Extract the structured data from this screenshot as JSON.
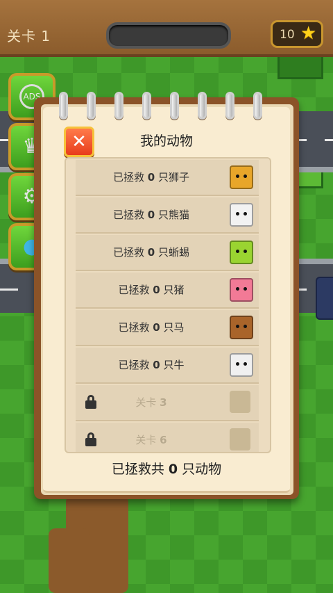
{
  "top_bar": {
    "level_label": "关卡 1",
    "progress_fraction": 0.0,
    "stars": "10",
    "star_icon": "star-icon"
  },
  "side_buttons": [
    {
      "icon": "no-ads-icon",
      "glyph": "ADS"
    },
    {
      "icon": "trophy-icon",
      "glyph": "🏆"
    },
    {
      "icon": "gear-icon",
      "glyph": "⚙"
    },
    {
      "icon": "bird-icon",
      "glyph": "🐦"
    }
  ],
  "panel": {
    "title": "我的动物",
    "close_icon": "close-icon",
    "rows": [
      {
        "prefix": "已拯救 ",
        "count": "0",
        "suffix": " 只狮子",
        "icon": "lion-icon",
        "color": "#e8a62a",
        "locked": false
      },
      {
        "prefix": "已拯救 ",
        "count": "0",
        "suffix": " 只熊猫",
        "icon": "panda-icon",
        "color": "#f2f2f2",
        "locked": false
      },
      {
        "prefix": "已拯救 ",
        "count": "0",
        "suffix": " 只蜥蜴",
        "icon": "lizard-icon",
        "color": "#9ad431",
        "locked": false
      },
      {
        "prefix": "已拯救 ",
        "count": "0",
        "suffix": " 只猪",
        "icon": "pig-icon",
        "color": "#f27a96",
        "locked": false
      },
      {
        "prefix": "已拯救 ",
        "count": "0",
        "suffix": " 只马",
        "icon": "horse-icon",
        "color": "#a9642a",
        "locked": false
      },
      {
        "prefix": "已拯救 ",
        "count": "0",
        "suffix": " 只牛",
        "icon": "cow-icon",
        "color": "#f0f0f0",
        "locked": false
      },
      {
        "prefix": "关卡 ",
        "count": "3",
        "suffix": "",
        "icon": "locked-animal-icon",
        "color": "#c9b895",
        "locked": true
      },
      {
        "prefix": "关卡 ",
        "count": "6",
        "suffix": "",
        "icon": "locked-animal-icon",
        "color": "#c9b895",
        "locked": true
      }
    ],
    "footer_prefix": "已拯救共 ",
    "footer_count": "0",
    "footer_suffix": " 只动物"
  }
}
